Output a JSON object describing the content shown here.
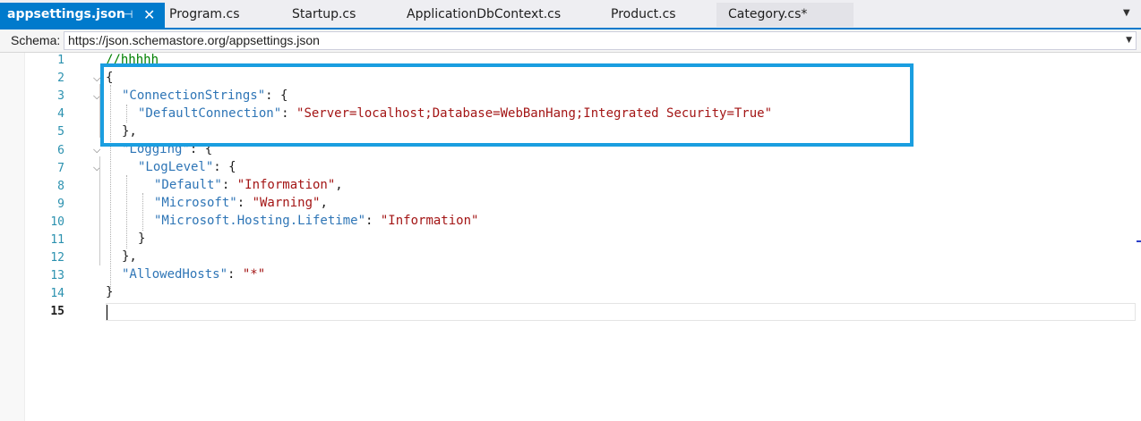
{
  "tabs": [
    {
      "label": "appsettings.json",
      "active": true
    },
    {
      "label": "Program.cs"
    },
    {
      "label": "Startup.cs"
    },
    {
      "label": "ApplicationDbContext.cs"
    },
    {
      "label": "Product.cs"
    },
    {
      "label": "Category.cs*"
    }
  ],
  "tab_icons": {
    "pin": "⊣",
    "close": "✕",
    "overflow": "▼"
  },
  "schema": {
    "label": "Schema:",
    "value": "https://json.schemastore.org/appsettings.json"
  },
  "line_numbers": [
    "1",
    "2",
    "3",
    "4",
    "5",
    "6",
    "7",
    "8",
    "9",
    "10",
    "11",
    "12",
    "13",
    "14",
    "15"
  ],
  "code": {
    "l1": {
      "comment": "//hhhhh"
    },
    "l2": {
      "p1": "{"
    },
    "l3": {
      "k": "\"ConnectionStrings\"",
      "p": ": {"
    },
    "l4": {
      "k": "\"DefaultConnection\"",
      "p": ": ",
      "s": "\"Server=localhost;Database=WebBanHang;Integrated Security=True\""
    },
    "l5": {
      "p": "},"
    },
    "l6": {
      "k": "\"Logging\"",
      "p": ": {"
    },
    "l7": {
      "k": "\"LogLevel\"",
      "p": ": {"
    },
    "l8": {
      "k": "\"Default\"",
      "p": ": ",
      "s": "\"Information\"",
      "e": ","
    },
    "l9": {
      "k": "\"Microsoft\"",
      "p": ": ",
      "s": "\"Warning\"",
      "e": ","
    },
    "l10": {
      "k": "\"Microsoft.Hosting.Lifetime\"",
      "p": ": ",
      "s": "\"Information\""
    },
    "l11": {
      "p": "}"
    },
    "l12": {
      "p": "},"
    },
    "l13": {
      "k": "\"AllowedHosts\"",
      "p": ": ",
      "s": "\"*\""
    },
    "l14": {
      "p": "}"
    }
  },
  "colors": {
    "accent": "#007acc",
    "highlight": "#1a9ee0",
    "key": "#2e75b6",
    "string": "#a31515",
    "comment": "#008000",
    "line_number": "#2b91af"
  }
}
